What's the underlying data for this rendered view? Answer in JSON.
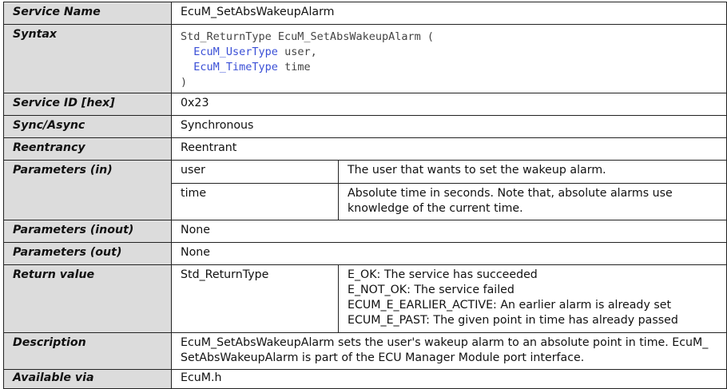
{
  "rows": {
    "service_name": {
      "label": "Service Name",
      "value": "EcuM_SetAbsWakeupAlarm"
    },
    "syntax": {
      "label": "Syntax",
      "line1": "Std_ReturnType EcuM_SetAbsWakeupAlarm (",
      "param1_type": "EcuM_UserType",
      "param1_name": " user,",
      "param2_type": "EcuM_TimeType",
      "param2_name": " time",
      "close": ")"
    },
    "service_id": {
      "label": "Service ID [hex]",
      "value": "0x23"
    },
    "sync": {
      "label": "Sync/Async",
      "value": "Synchronous"
    },
    "reentrancy": {
      "label": "Reentrancy",
      "value": "Reentrant"
    },
    "params_in": {
      "label": "Parameters (in)",
      "items": [
        {
          "name": "user",
          "desc": "The user that wants to set the wakeup alarm."
        },
        {
          "name": "time",
          "desc1": "Absolute time in seconds. Note that, absolute alarms use",
          "desc2": "knowledge of the current time."
        }
      ]
    },
    "params_inout": {
      "label": "Parameters (inout)",
      "value": "None"
    },
    "params_out": {
      "label": "Parameters (out)",
      "value": "None"
    },
    "return_value": {
      "label": "Return value",
      "type": "Std_ReturnType",
      "lines": [
        "E_OK: The service has succeeded",
        "E_NOT_OK: The service failed",
        "ECUM_E_EARLIER_ACTIVE: An earlier alarm is already set",
        "ECUM_E_PAST: The given point in time has already passed"
      ]
    },
    "description": {
      "label": "Description",
      "line1": "EcuM_SetAbsWakeupAlarm sets the user's wakeup alarm to an absolute point in time. EcuM_",
      "line2": "SetAbsWakeupAlarm is part of the ECU Manager Module port interface."
    },
    "available_via": {
      "label": "Available via",
      "value": "EcuM.h"
    }
  }
}
